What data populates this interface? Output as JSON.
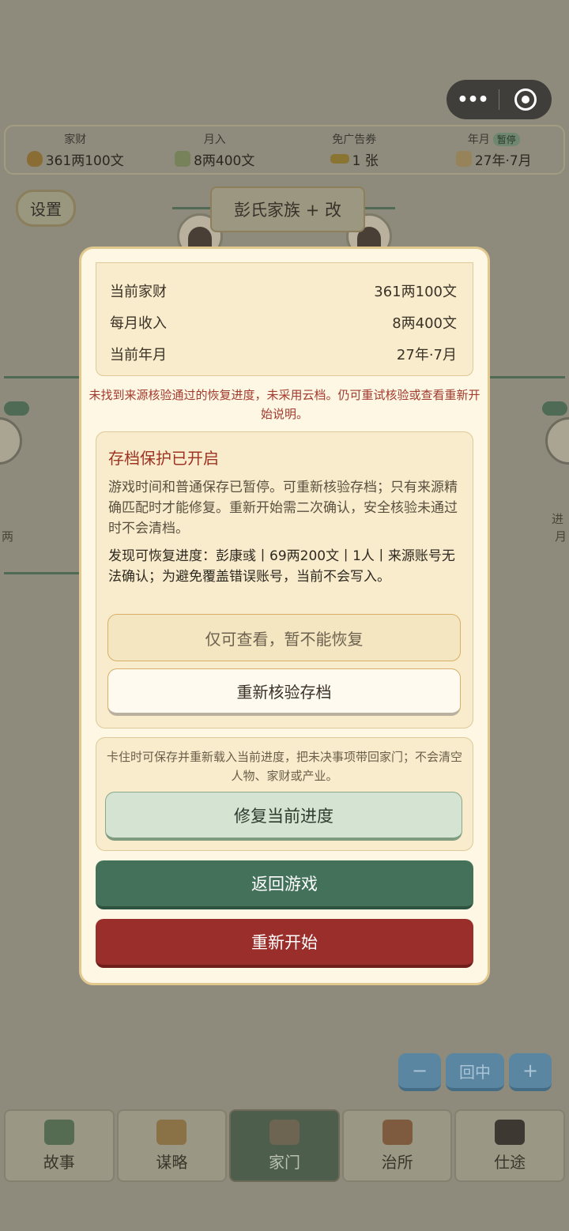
{
  "status_bar": {
    "wealth": {
      "label": "家财",
      "value": "361两100文",
      "icon": "money-bag-icon",
      "icon_color": "#b8893a"
    },
    "income": {
      "label": "月入",
      "value": "8两400文",
      "icon": "banknote-icon",
      "icon_color": "#9aa86a"
    },
    "ad_ticket": {
      "label": "免广告券",
      "value": "1 张",
      "icon": "ticket-icon",
      "icon_color": "#b89a3c"
    },
    "date": {
      "label": "年月",
      "paused_tag": "暂停",
      "value": "27年·7月",
      "icon": "scroll-icon",
      "icon_color": "#c2a56a"
    }
  },
  "settings_label": "设置",
  "family_title": "彭氏家族 + 改",
  "background": {
    "left_edge_text": "两",
    "right_edge_text_1": "进",
    "right_edge_text_2": "月"
  },
  "modal": {
    "summary_rows": [
      {
        "label": "当前家财",
        "value": "361两100文"
      },
      {
        "label": "每月收入",
        "value": "8两400文"
      },
      {
        "label": "当前年月",
        "value": "27年·7月"
      }
    ],
    "warning": "未找到来源核验通过的恢复进度，未采用云档。仍可重试核验或查看重新开始说明。",
    "protection": {
      "title": "存档保护已开启",
      "description": "游戏时间和普通保存已暂停。可重新核验存档；只有来源精确匹配时才能修复。重新开始需二次确认，安全核验未通过时不会清档。",
      "found": "发现可恢复进度：彭康彧丨69两200文丨1人丨来源账号无法确认；为避免覆盖错误账号，当前不会写入。",
      "view_only_button": "仅可查看，暂不能恢复",
      "recheck_button": "重新核验存档"
    },
    "repair": {
      "description": "卡住时可保存并重新载入当前进度，把未决事项带回家门；不会清空人物、家财或产业。",
      "button": "修复当前进度"
    },
    "return_button": "返回游戏",
    "restart_button": "重新开始"
  },
  "zoom": {
    "minus": "−",
    "center": "回中",
    "plus": "+"
  },
  "nav": [
    {
      "label": "故事",
      "icon": "book-icon",
      "color": "#5c7a5a"
    },
    {
      "label": "谋略",
      "icon": "map-icon",
      "color": "#9a7a4a"
    },
    {
      "label": "家门",
      "icon": "house-icon",
      "color": "#7a6a52"
    },
    {
      "label": "治所",
      "icon": "pagoda-icon",
      "color": "#8a5a3a"
    },
    {
      "label": "仕途",
      "icon": "official-hat-icon",
      "color": "#4a4038"
    }
  ]
}
